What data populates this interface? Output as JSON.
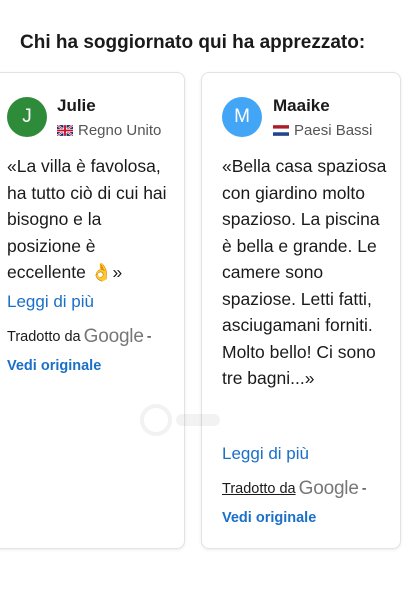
{
  "section": {
    "title": "Chi ha soggiornato qui ha apprezzato:"
  },
  "reviews": [
    {
      "initial": "J",
      "avatar_color": "#2e8b3a",
      "name": "Julie",
      "country": "Regno Unito",
      "flag_icon": "uk-flag-icon",
      "text": "«La villa è favolosa, ha tutto ciò di cui hai bisogno e la posizione è eccellente 👌»",
      "read_more": "Leggi di più",
      "translated_by": "Tradotto da",
      "google": "Google",
      "dash": "-",
      "view_original": "Vedi originale"
    },
    {
      "initial": "M",
      "avatar_color": "#42a5f5",
      "name": "Maaike",
      "country": "Paesi Bassi",
      "flag_icon": "netherlands-flag-icon",
      "text": "«Bella casa spaziosa con giardino molto spazioso. La piscina è bella e grande. Le camere sono spaziose. Letti fatti, asciugamani forniti. Molto bello! Ci sono tre bagni...»",
      "read_more": "Leggi di più",
      "translated_by": "Tradotto da",
      "google": "Google",
      "dash": "-",
      "view_original": "Vedi originale"
    }
  ],
  "colors": {
    "link": "#1a6fc9",
    "border": "#e3e3e3"
  }
}
